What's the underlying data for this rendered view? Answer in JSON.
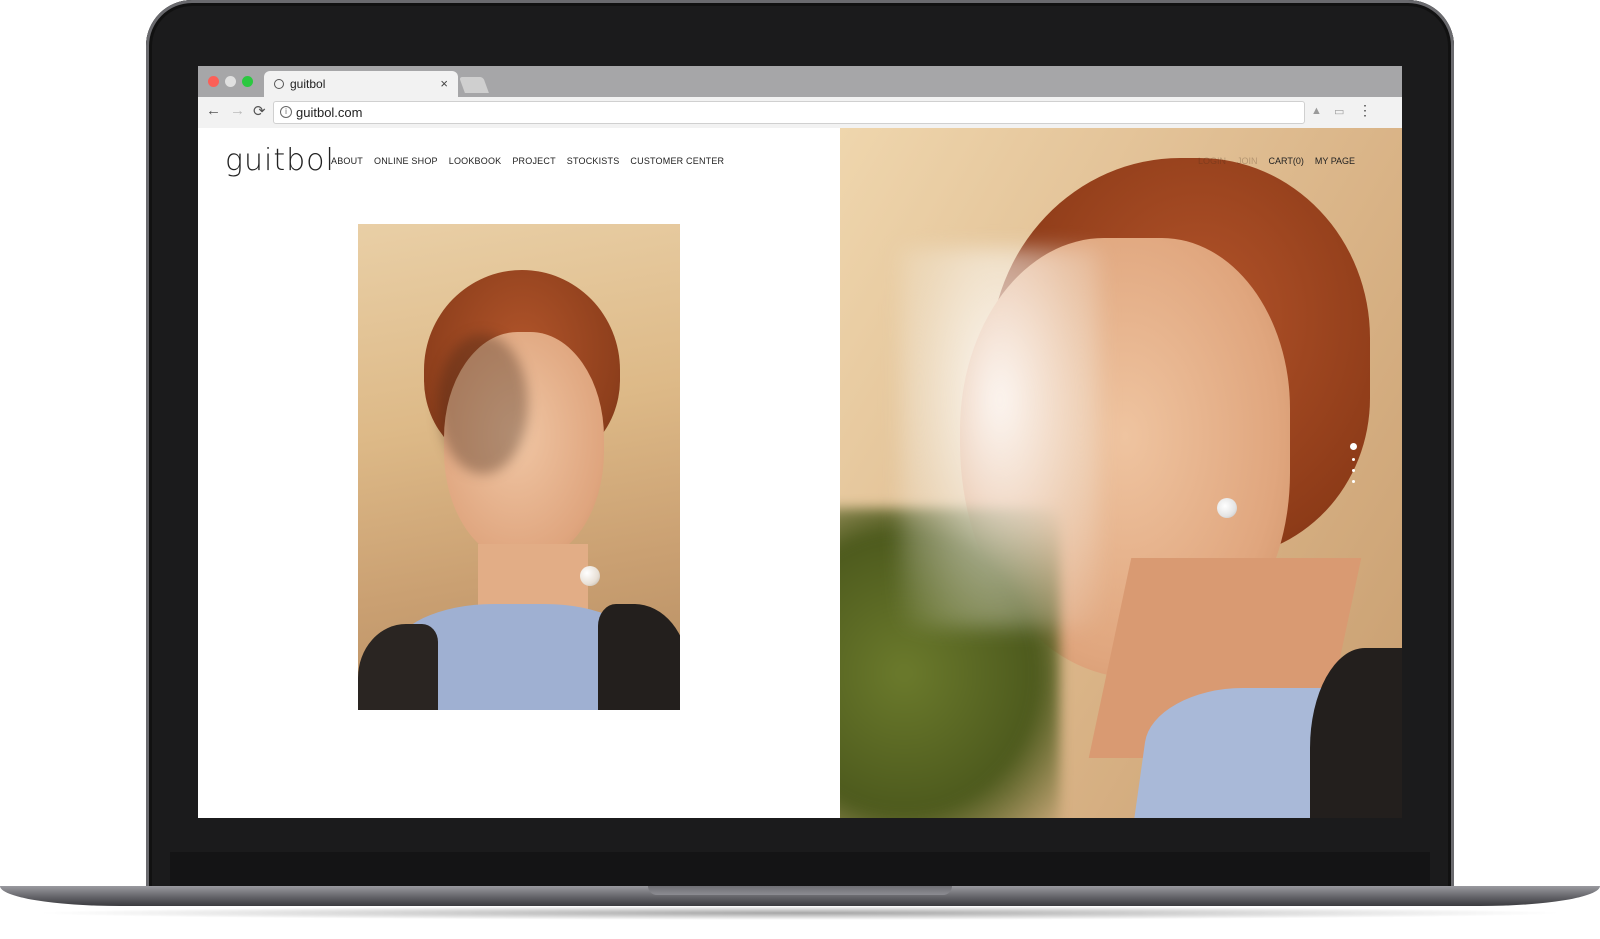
{
  "browser": {
    "tab": {
      "title": "guitbol",
      "close_label": "×"
    },
    "url": "guitbol.com",
    "nav": {
      "back": "←",
      "forward": "→",
      "reload": "⟳"
    },
    "menu": "⋮",
    "info_glyph": "i"
  },
  "site": {
    "logo": "guitbol",
    "main_nav": [
      "ABOUT",
      "ONLINE SHOP",
      "LOOKBOOK",
      "PROJECT",
      "STOCKISTS",
      "CUSTOMER CENTER"
    ],
    "util_nav": [
      "LOGIN",
      "JOIN",
      "CART(0)",
      "MY PAGE"
    ],
    "slider": {
      "total": 4,
      "active_index": 1
    }
  },
  "colors": {
    "traffic_red": "#fc5f57",
    "traffic_green": "#2bc840",
    "nav_text": "#222222"
  }
}
